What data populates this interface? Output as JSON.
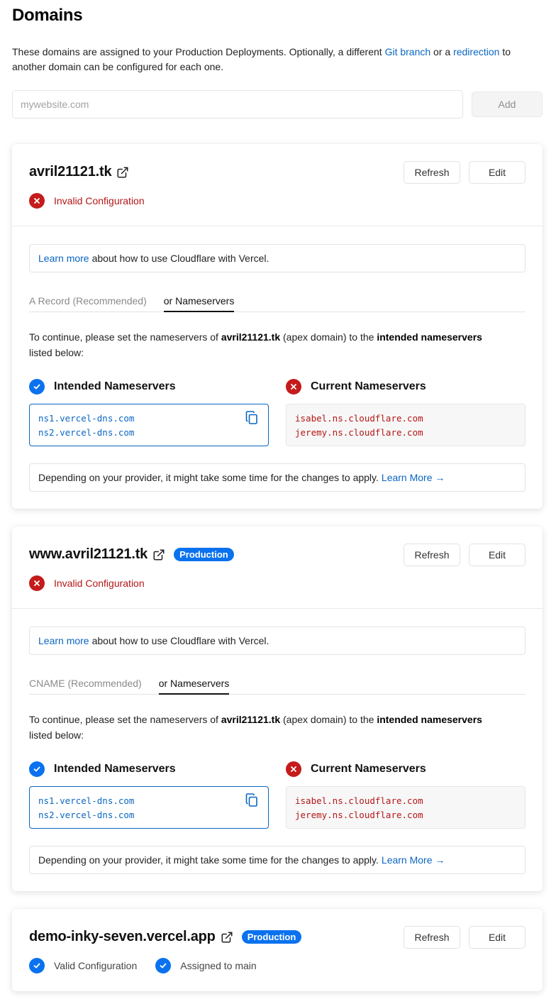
{
  "page": {
    "title": "Domains",
    "intro_before": "These domains are assigned to your Production Deployments. Optionally, a different",
    "intro_link1": "Git branch",
    "intro_mid": "or a",
    "intro_link2": "redirection",
    "intro_after": "to another domain can be configured for each one."
  },
  "add_domain": {
    "placeholder": "mywebsite.com",
    "value": "",
    "button_label": "Add"
  },
  "domains": [
    {
      "name": "avril21121.tk",
      "badge": "",
      "refresh_label": "Refresh",
      "edit_label": "Edit",
      "status": "Invalid Configuration",
      "info_link": "Learn more",
      "info_text": "about how to use Cloudflare with Vercel.",
      "tabs": [
        "A Record (Recommended)",
        "or Nameservers"
      ],
      "active_tab": 1,
      "instr_part1": "To continue, please set the nameservers of",
      "instr_domain": "avril21121.tk",
      "instr_part2": "(apex domain) to the",
      "instr_bold": "intended nameservers",
      "instr_part3": "listed below:",
      "intended_heading": "Intended Nameservers",
      "current_heading": "Current Nameservers",
      "intended_ns": [
        "ns1.vercel-dns.com",
        "ns2.vercel-dns.com"
      ],
      "current_ns": [
        "isabel.ns.cloudflare.com",
        "jeremy.ns.cloudflare.com"
      ],
      "note_text": "Depending on your provider, it might take some time for the changes to apply.",
      "note_link": "Learn More →"
    },
    {
      "name": "www.avril21121.tk",
      "badge": "Production",
      "refresh_label": "Refresh",
      "edit_label": "Edit",
      "status": "Invalid Configuration",
      "info_link": "Learn more",
      "info_text": "about how to use Cloudflare with Vercel.",
      "tabs": [
        "CNAME (Recommended)",
        "or Nameservers"
      ],
      "active_tab": 1,
      "instr_part1": "To continue, please set the nameservers of",
      "instr_domain": "avril21121.tk",
      "instr_part2": "(apex domain) to the",
      "instr_bold": "intended nameservers",
      "instr_part3": "listed below:",
      "intended_heading": "Intended Nameservers",
      "current_heading": "Current Nameservers",
      "intended_ns": [
        "ns1.vercel-dns.com",
        "ns2.vercel-dns.com"
      ],
      "current_ns": [
        "isabel.ns.cloudflare.com",
        "jeremy.ns.cloudflare.com"
      ],
      "note_text": "Depending on your provider, it might take some time for the changes to apply.",
      "note_link": "Learn More →"
    },
    {
      "name": "demo-inky-seven.vercel.app",
      "badge": "Production",
      "refresh_label": "Refresh",
      "edit_label": "Edit",
      "status_valid": "Valid Configuration",
      "status_assigned": "Assigned to main"
    }
  ],
  "icons": {
    "external_link": "external-link-icon",
    "error": "x-circle-icon",
    "success": "check-circle-icon",
    "copy": "copy-icon"
  },
  "colors": {
    "accent_blue": "#0a72ef",
    "link_blue": "#0a66c2",
    "error_red": "#c51b1b",
    "error_text": "#b41616"
  }
}
